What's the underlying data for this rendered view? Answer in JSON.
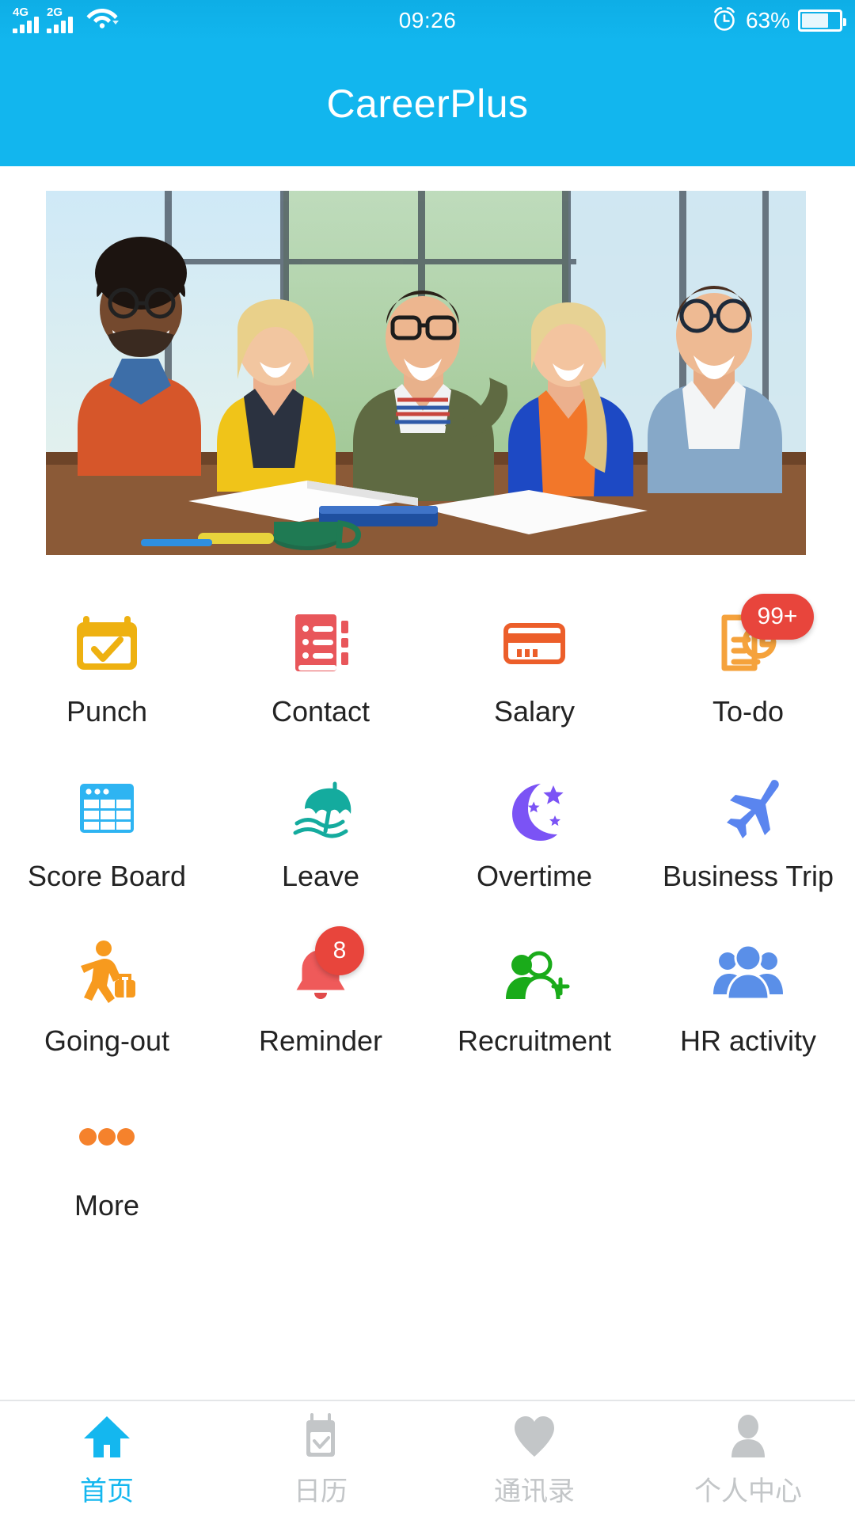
{
  "status_bar": {
    "network_1": "4G",
    "network_2": "2G",
    "wifi_icon": "wifi-icon",
    "time": "09:26",
    "alarm_icon": "alarm-clock-icon",
    "battery_percent": "63%",
    "battery_level": 63
  },
  "header": {
    "title": "CareerPlus",
    "background_color": "#12b6ee"
  },
  "banner": {
    "alt": "group of smiling colleagues at a table with books"
  },
  "grid": {
    "items": [
      {
        "label": "Punch",
        "icon": "calendar-check-icon",
        "color": "#eeb111",
        "badge": null
      },
      {
        "label": "Contact",
        "icon": "address-book-icon",
        "color": "#e8565a",
        "badge": null
      },
      {
        "label": "Salary",
        "icon": "credit-card-icon",
        "color": "#ec5e2a",
        "badge": null
      },
      {
        "label": "To-do",
        "icon": "document-clock-icon",
        "color": "#f5a23c",
        "badge": "99+"
      },
      {
        "label": "Score Board",
        "icon": "table-grid-icon",
        "color": "#2eb4f2",
        "badge": null
      },
      {
        "label": "Leave",
        "icon": "beach-umbrella-icon",
        "color": "#14ab9e",
        "badge": null
      },
      {
        "label": "Overtime",
        "icon": "moon-stars-icon",
        "color": "#7b53f5",
        "badge": null
      },
      {
        "label": "Business Trip",
        "icon": "airplane-icon",
        "color": "#5a85ef",
        "badge": null
      },
      {
        "label": "Going-out",
        "icon": "walking-traveler-icon",
        "color": "#f79a1e",
        "badge": null
      },
      {
        "label": "Reminder",
        "icon": "bell-icon",
        "color": "#ef5a5a",
        "badge": "8"
      },
      {
        "label": "Recruitment",
        "icon": "add-person-icon",
        "color": "#1aab1a",
        "badge": null
      },
      {
        "label": "HR activity",
        "icon": "people-group-icon",
        "color": "#5a8fe8",
        "badge": null
      },
      {
        "label": "More",
        "icon": "ellipsis-icon",
        "color": "#f5822c",
        "badge": null
      }
    ]
  },
  "tab_bar": {
    "tabs": [
      {
        "label": "首页",
        "icon": "home-icon",
        "active": true
      },
      {
        "label": "日历",
        "icon": "calendar-check-icon",
        "active": false
      },
      {
        "label": "通讯录",
        "icon": "heart-icon",
        "active": false
      },
      {
        "label": "个人中心",
        "icon": "person-icon",
        "active": false
      }
    ]
  },
  "colors": {
    "accent": "#12b6ee",
    "badge_red": "#e8453c",
    "inactive_gray": "#c3c6c8"
  }
}
